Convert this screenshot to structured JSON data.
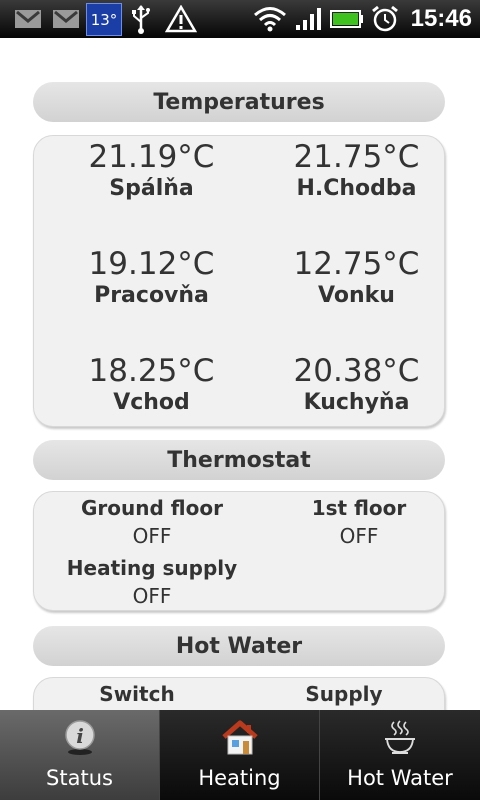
{
  "status_bar": {
    "temperature_badge": "13°",
    "clock": "15:46",
    "icons": [
      "gmail-icon",
      "gmail-icon",
      "temperature-badge",
      "usb-icon",
      "warning-icon",
      "wifi-icon",
      "signal-icon",
      "battery-icon",
      "alarm-icon"
    ]
  },
  "temperatures": {
    "header": "Temperatures",
    "items": [
      {
        "value": "21.19°C",
        "label": "Spálňa"
      },
      {
        "value": "21.75°C",
        "label": "H.Chodba"
      },
      {
        "value": "19.12°C",
        "label": "Pracovňa"
      },
      {
        "value": "12.75°C",
        "label": "Vonku"
      },
      {
        "value": "18.25°C",
        "label": "Vchod"
      },
      {
        "value": "20.38°C",
        "label": "Kuchyňa"
      }
    ]
  },
  "thermostat": {
    "header": "Thermostat",
    "items": [
      {
        "label": "Ground floor",
        "value": "OFF"
      },
      {
        "label": "1st floor",
        "value": "OFF"
      },
      {
        "label": "Heating supply",
        "value": "OFF"
      }
    ]
  },
  "hot_water": {
    "header": "Hot Water",
    "items": [
      {
        "label": "Switch"
      },
      {
        "label": "Supply"
      }
    ]
  },
  "tabs": [
    {
      "label": "Status",
      "icon": "info-icon",
      "active": true
    },
    {
      "label": "Heating",
      "icon": "house-icon",
      "active": false
    },
    {
      "label": "Hot Water",
      "icon": "hot-water-icon",
      "active": false
    }
  ],
  "colors": {
    "status_bar_bg": "#000000",
    "temp_badge_bg": "#1b3ea6",
    "battery": "#3fc21f",
    "section_header_bg": "#dcdcdc",
    "panel_bg": "#f1f1f1",
    "text": "#333333",
    "tab_active_bg": "#5a5a5a"
  }
}
